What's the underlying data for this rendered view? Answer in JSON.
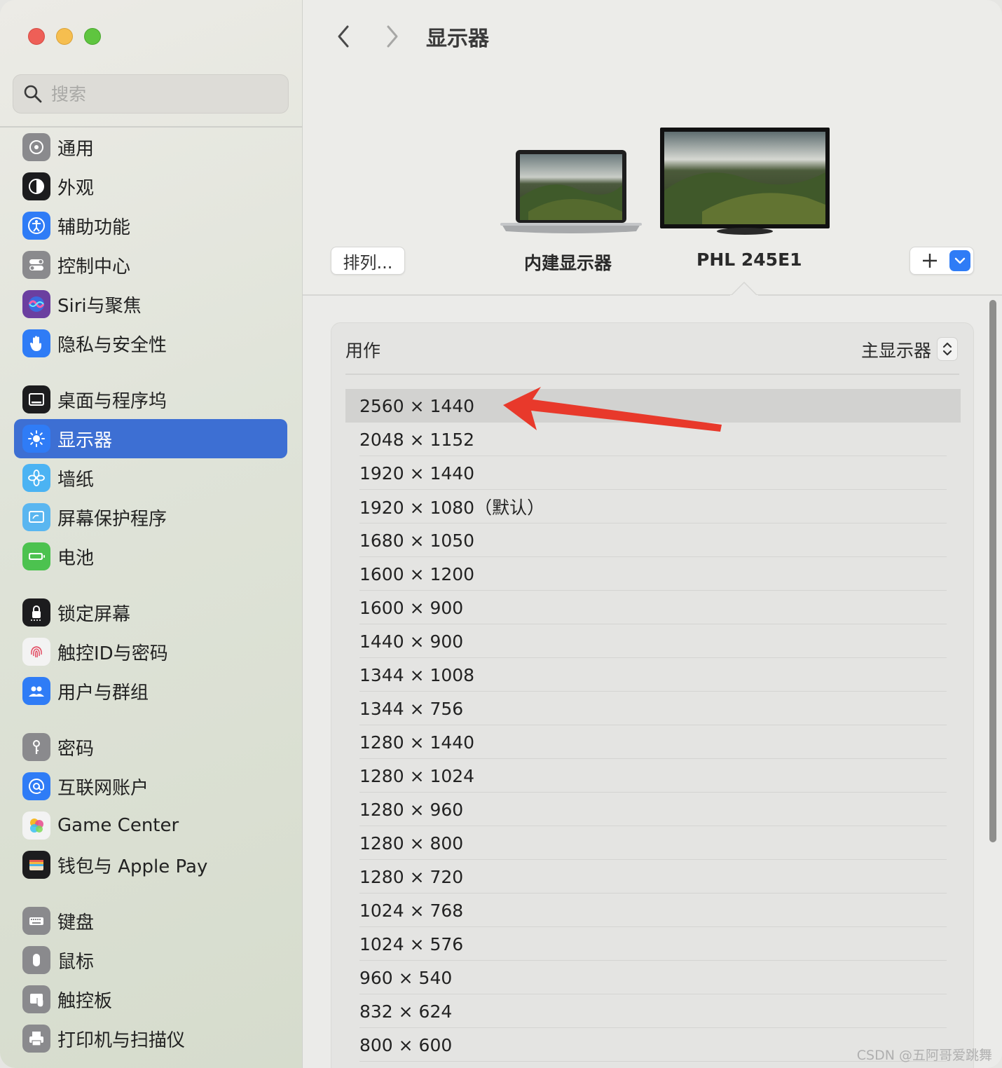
{
  "window": {
    "title": "显示器"
  },
  "search": {
    "placeholder": "搜索"
  },
  "sidebar": {
    "groups": [
      [
        {
          "label": "通用",
          "icon": "gear-icon",
          "color": "#8a8a8d"
        },
        {
          "label": "外观",
          "icon": "appearance-icon",
          "color": "#1c1c1e"
        },
        {
          "label": "辅助功能",
          "icon": "accessibility-icon",
          "color": "#2f7cf6"
        },
        {
          "label": "控制中心",
          "icon": "control-center-icon",
          "color": "#8a8a8d"
        },
        {
          "label": "Siri与聚焦",
          "icon": "siri-icon",
          "color": "#6b3fa0"
        },
        {
          "label": "隐私与安全性",
          "icon": "hand-icon",
          "color": "#2f7cf6"
        }
      ],
      [
        {
          "label": "桌面与程序坞",
          "icon": "dock-icon",
          "color": "#1c1c1e"
        },
        {
          "label": "显示器",
          "icon": "sun-icon",
          "color": "#2f7cf6",
          "active": true
        },
        {
          "label": "墙纸",
          "icon": "flower-icon",
          "color": "#4bb3f3"
        },
        {
          "label": "屏幕保护程序",
          "icon": "screensaver-icon",
          "color": "#5ab6f0"
        },
        {
          "label": "电池",
          "icon": "battery-icon",
          "color": "#4cc24f"
        }
      ],
      [
        {
          "label": "锁定屏幕",
          "icon": "lock-icon",
          "color": "#1c1c1e"
        },
        {
          "label": "触控ID与密码",
          "icon": "fingerprint-icon",
          "color": "#f3f3f3"
        },
        {
          "label": "用户与群组",
          "icon": "users-icon",
          "color": "#2f7cf6"
        }
      ],
      [
        {
          "label": "密码",
          "icon": "key-icon",
          "color": "#8a8a8d"
        },
        {
          "label": "互联网账户",
          "icon": "at-icon",
          "color": "#2f7cf6"
        },
        {
          "label": "Game Center",
          "icon": "game-center-icon",
          "color": "#f3f3f3"
        },
        {
          "label": "钱包与 Apple Pay",
          "icon": "wallet-icon",
          "color": "#1c1c1e"
        }
      ],
      [
        {
          "label": "键盘",
          "icon": "keyboard-icon",
          "color": "#8a8a8d"
        },
        {
          "label": "鼠标",
          "icon": "mouse-icon",
          "color": "#8a8a8d"
        },
        {
          "label": "触控板",
          "icon": "trackpad-icon",
          "color": "#8a8a8d"
        },
        {
          "label": "打印机与扫描仪",
          "icon": "printer-icon",
          "color": "#8a8a8d"
        }
      ]
    ]
  },
  "main": {
    "arrange_label": "排列...",
    "displays": [
      {
        "label": "内建显示器",
        "icon": "laptop-icon"
      },
      {
        "label": "PHL 245E1",
        "icon": "monitor-icon",
        "selected": true
      }
    ],
    "use_as": {
      "label": "用作",
      "value": "主显示器"
    },
    "resolutions": [
      "2560 × 1440",
      "2048 × 1152",
      "1920 × 1440",
      "1920 × 1080（默认）",
      "1680 × 1050",
      "1600 × 1200",
      "1600 × 900",
      "1440 × 900",
      "1344 × 1008",
      "1344 × 756",
      "1280 × 1440",
      "1280 × 1024",
      "1280 × 960",
      "1280 × 800",
      "1280 × 720",
      "1024 × 768",
      "1024 × 576",
      "960 × 540",
      "832 × 624",
      "800 × 600"
    ],
    "selected_resolution": "2560 × 1440"
  },
  "watermark": "CSDN @五阿哥爱跳舞",
  "colors": {
    "accent": "#3d6fd3",
    "annotation_arrow": "#e8392b"
  }
}
